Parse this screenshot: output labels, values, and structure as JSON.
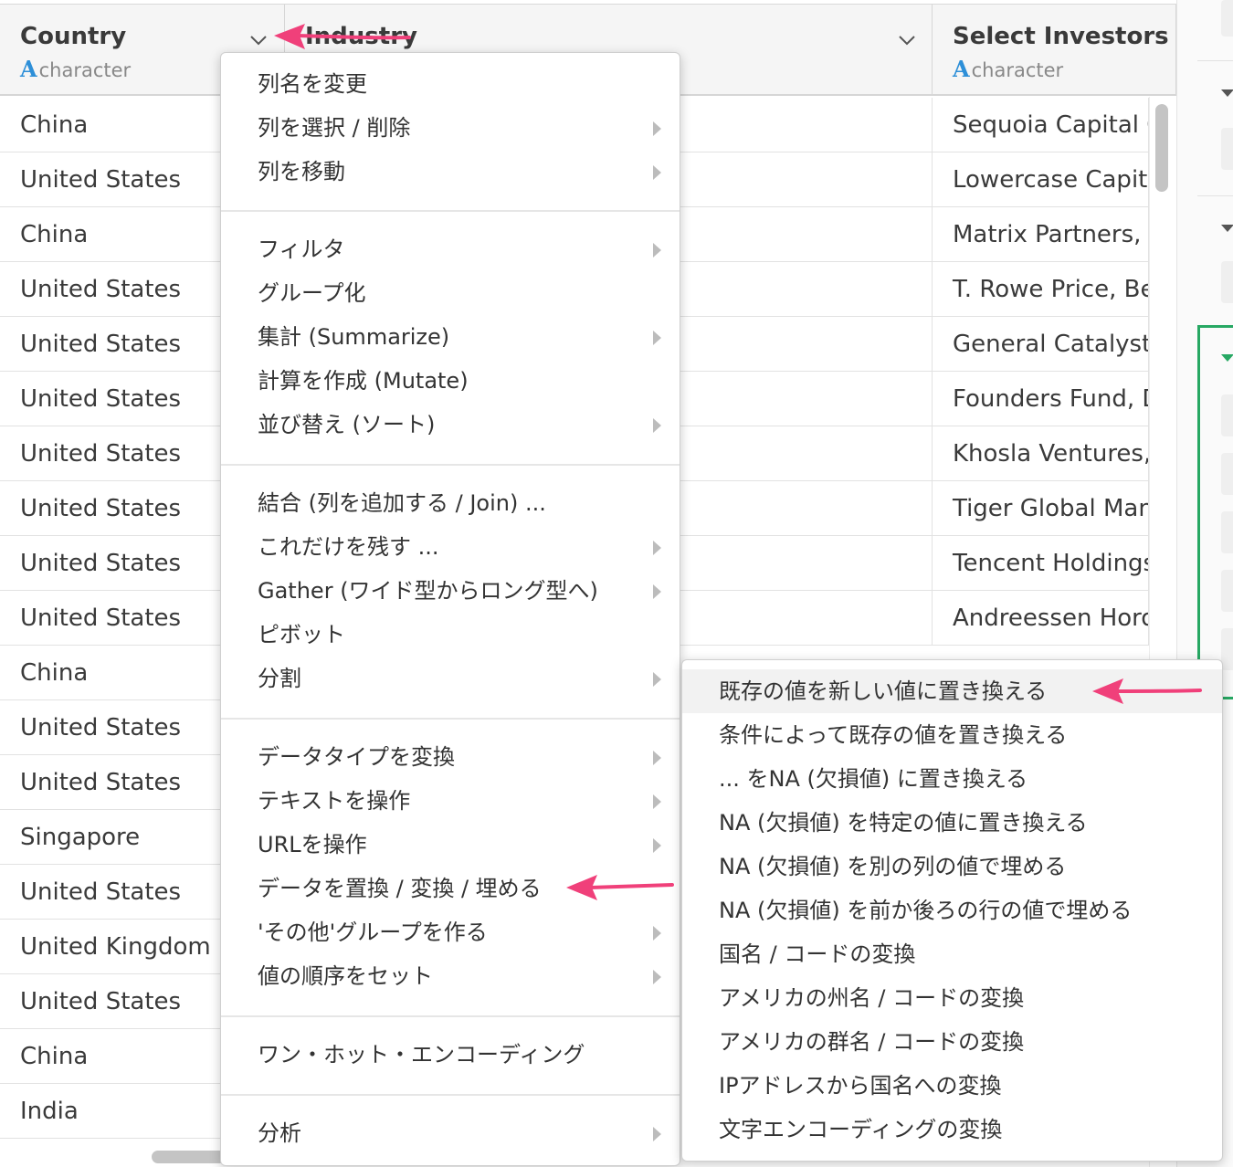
{
  "columns": [
    {
      "name": "Country",
      "type_icon": "A",
      "type": "character"
    },
    {
      "name": "Industry",
      "type_icon": "A",
      "type": "character"
    },
    {
      "name": "Select Investors",
      "type_icon": "A",
      "type": "character"
    }
  ],
  "rows": [
    {
      "country": "China",
      "investors": "Sequoia Capital C"
    },
    {
      "country": "United States",
      "investors": "Lowercase Capital"
    },
    {
      "country": "China",
      "investors": "Matrix Partners, T"
    },
    {
      "country": "United States",
      "investors": "T. Rowe Price, Be"
    },
    {
      "country": "United States",
      "investors": "General Catalyst"
    },
    {
      "country": "United States",
      "investors": "Founders Fund, D"
    },
    {
      "country": "United States",
      "investors": "Khosla Ventures,"
    },
    {
      "country": "United States",
      "investors": "Tiger Global Man"
    },
    {
      "country": "United States",
      "investors": "Tencent Holdings"
    },
    {
      "country": "United States",
      "investors": "Andreessen Horo"
    },
    {
      "country": "China",
      "investors": ""
    },
    {
      "country": "United States",
      "investors": ""
    },
    {
      "country": "United States",
      "investors": ""
    },
    {
      "country": "Singapore",
      "investors": ""
    },
    {
      "country": "United States",
      "investors": ""
    },
    {
      "country": "United Kingdom",
      "investors": ""
    },
    {
      "country": "United States",
      "investors": ""
    },
    {
      "country": "China",
      "investors": ""
    },
    {
      "country": "India",
      "investors": ""
    }
  ],
  "column_menu": {
    "groups": [
      [
        {
          "label": "列名を変更",
          "submenu": false
        },
        {
          "label": "列を選択 / 削除",
          "submenu": true
        },
        {
          "label": "列を移動",
          "submenu": true
        }
      ],
      [
        {
          "label": "フィルタ",
          "submenu": true
        },
        {
          "label": "グループ化",
          "submenu": false
        },
        {
          "label": "集計 (Summarize)",
          "submenu": true
        },
        {
          "label": "計算を作成 (Mutate)",
          "submenu": false
        },
        {
          "label": "並び替え (ソート)",
          "submenu": true
        }
      ],
      [
        {
          "label": "結合 (列を追加する / Join) ...",
          "submenu": false
        },
        {
          "label": "これだけを残す ...",
          "submenu": true
        },
        {
          "label": "Gather (ワイド型からロング型へ)",
          "submenu": true
        },
        {
          "label": "ピボット",
          "submenu": false
        },
        {
          "label": "分割",
          "submenu": true
        }
      ],
      [
        {
          "label": "データタイプを変換",
          "submenu": true
        },
        {
          "label": "テキストを操作",
          "submenu": true
        },
        {
          "label": "URLを操作",
          "submenu": true
        },
        {
          "label": "データを置換 / 変換 / 埋める",
          "submenu": false
        },
        {
          "label": "'その他'グループを作る",
          "submenu": true
        },
        {
          "label": "値の順序をセット",
          "submenu": true
        }
      ],
      [
        {
          "label": "ワン・ホット・エンコーディング",
          "submenu": false
        }
      ],
      [
        {
          "label": "分析",
          "submenu": true
        }
      ]
    ]
  },
  "replace_submenu": {
    "items": [
      "既存の値を新しい値に置き換える",
      "条件によって既存の値を置き換える",
      "... をNA (欠損値) に置き換える",
      "NA (欠損値) を特定の値に置き換える",
      "NA (欠損値) を別の列の値で埋める",
      "NA (欠損値) を前か後ろの行の値で埋める",
      "国名 / コードの変換",
      "アメリカの州名 / コードの変換",
      "アメリカの群名 / コードの変換",
      "IPアドレスから国名への変換",
      "文字エンコーディングの変換"
    ],
    "highlighted_index": 0
  },
  "colors": {
    "annotation_arrow": "#f0407a",
    "type_icon": "#2d8fd8",
    "selected_step": "#27a863"
  },
  "icons": [
    "chevron-down-icon",
    "submenu-arrow-icon",
    "annotation-arrow-icon"
  ]
}
